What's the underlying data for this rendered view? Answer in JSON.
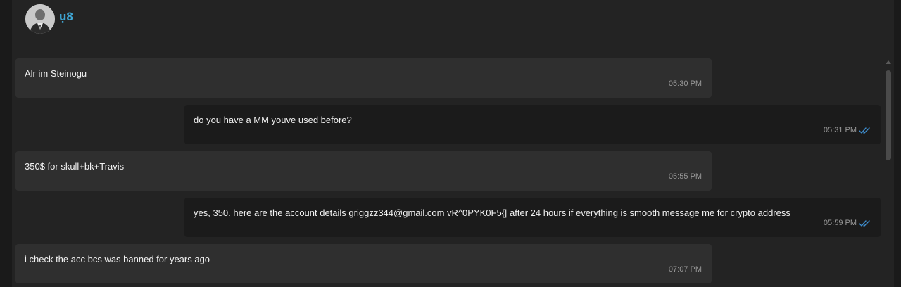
{
  "header": {
    "username": "ụ8"
  },
  "messages": [
    {
      "direction": "in",
      "text": "Alr im Steinogu",
      "time": "05:30 PM"
    },
    {
      "direction": "out",
      "text": "do you have a MM youve used before?",
      "time": "05:31 PM",
      "status": "read"
    },
    {
      "direction": "in",
      "text": "350$ for skull+bk+Travis",
      "time": "05:55 PM"
    },
    {
      "direction": "out",
      "text": "yes, 350. here are the account details griggzz344@gmail.com vR^0PYK0F5{| after 24 hours if everything is smooth message me for crypto address",
      "time": "05:59 PM",
      "status": "read"
    },
    {
      "direction": "in",
      "text": "i check the acc bcs was banned for years ago",
      "time": "07:07 PM"
    }
  ],
  "colors": {
    "accent": "#3fa6d4",
    "read_ticks": "#3f8fd0"
  },
  "icons": {
    "avatar": "user-avatar",
    "read_status": "double-check-icon"
  }
}
